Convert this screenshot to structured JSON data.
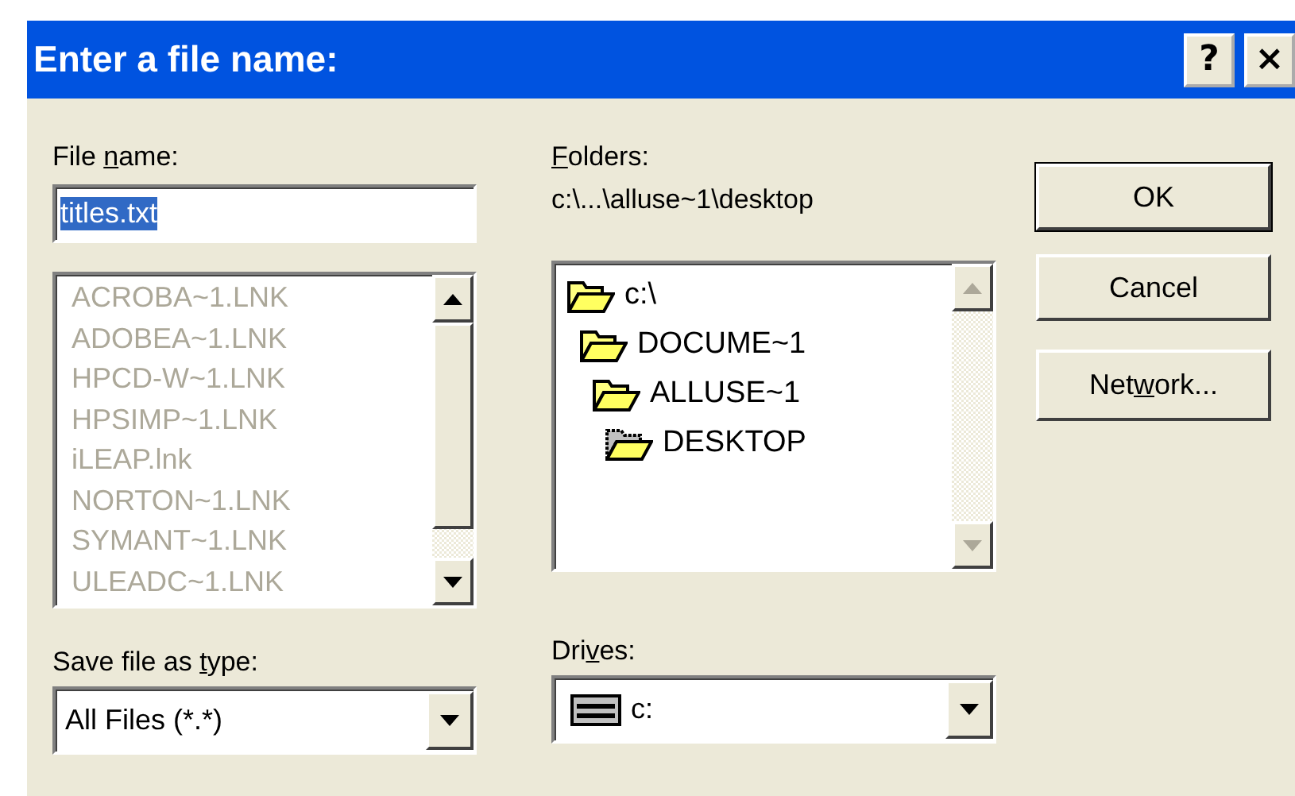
{
  "window": {
    "title": "Enter a file name:",
    "help_button": "?",
    "close_button": "×"
  },
  "file_name": {
    "label": {
      "before": "File ",
      "key": "n",
      "after": "ame:"
    },
    "value": "titles.txt",
    "value_selected": true
  },
  "files": [
    {
      "name": "ACROBA~1.LNK",
      "disabled": true
    },
    {
      "name": "ADOBEA~1.LNK",
      "disabled": true
    },
    {
      "name": "HPCD-W~1.LNK",
      "disabled": true
    },
    {
      "name": "HPSIMP~1.LNK",
      "disabled": true
    },
    {
      "name": "iLEAP.lnk",
      "disabled": true
    },
    {
      "name": "NORTON~1.LNK",
      "disabled": true
    },
    {
      "name": "SYMANT~1.LNK",
      "disabled": true
    },
    {
      "name": "ULEADC~1.LNK",
      "disabled": true
    }
  ],
  "folders": {
    "label": {
      "key": "F",
      "after": "olders:"
    },
    "path": "c:\\...\\alluse~1\\desktop",
    "tree": [
      {
        "name": "c:\\",
        "current": false,
        "children": [
          {
            "name": "DOCUME~1",
            "current": false,
            "children": [
              {
                "name": "ALLUSE~1",
                "current": false,
                "children": [
                  {
                    "name": "DESKTOP",
                    "current": true
                  }
                ]
              }
            ]
          }
        ]
      }
    ]
  },
  "save_type": {
    "label": {
      "before": "Save file as ",
      "key": "t",
      "after": "ype:"
    },
    "value": "All Files (*.*)"
  },
  "drives": {
    "label": {
      "before": "Dri",
      "key": "v",
      "after": "es:"
    },
    "value": "c:"
  },
  "buttons": [
    {
      "label": {
        "before": "OK"
      },
      "default": true
    },
    {
      "label": {
        "before": "Cancel"
      },
      "default": false
    },
    {
      "label": {
        "before": "Net",
        "key": "w",
        "after": "ork..."
      },
      "default": false
    }
  ]
}
